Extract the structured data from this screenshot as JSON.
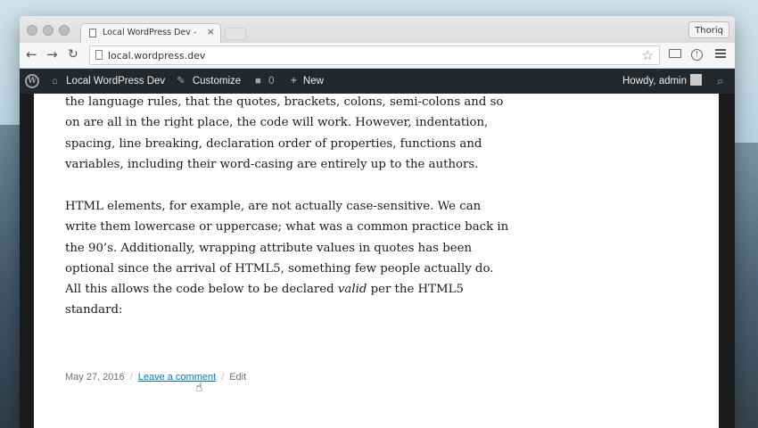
{
  "browser": {
    "tab_title": "Local WordPress Dev – Jus",
    "profile_name": "Thoriq",
    "url": "local.wordpress.dev"
  },
  "adminbar": {
    "site_name": "Local WordPress Dev",
    "customize": "Customize",
    "comments_count": "0",
    "new_label": "New",
    "howdy": "Howdy, admin"
  },
  "article": {
    "paragraph1_lines": [
      "the language rules, that the quotes, brackets, colons, semi-colons and so",
      "on are all in the right place, the code will work. However, indentation,",
      "spacing, line breaking, declaration order of properties, functions and",
      "variables, including their word-casing are entirely up to the authors."
    ],
    "paragraph2_lines": [
      "HTML elements, for example, are not actually case-sensitive. We can",
      "write them lowercase or uppercase; what was a common practice back in",
      "the 90’s. Additionally, wrapping attribute values in quotes has been",
      "optional since the arrival of HTML5, something few people actually do."
    ],
    "paragraph2_line5_before": "All this allows the code below to be declared ",
    "paragraph2_line5_em": "valid",
    "paragraph2_line5_after": " per the HTML5",
    "paragraph2_line6": "standard:",
    "meta": {
      "date": "May 27, 2016",
      "separator": "/",
      "comment_link": "Leave a comment",
      "edit_link": "Edit"
    }
  },
  "colors": {
    "adminbar": "#23282d",
    "link": "#007acc"
  }
}
